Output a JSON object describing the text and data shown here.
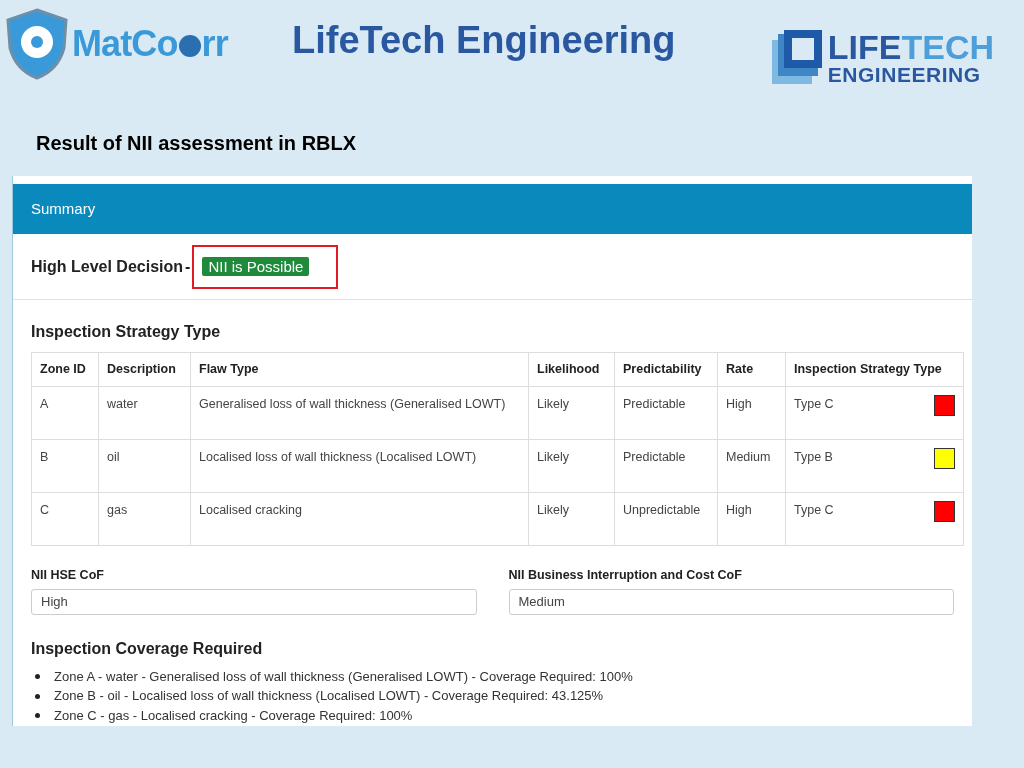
{
  "header": {
    "left_logo": {
      "text_a": "Mat",
      "text_b": "Co",
      "text_c": "rr"
    },
    "title": "LifeTech Engineering",
    "right_logo": {
      "line_1a": "LIFE",
      "line_1b": "TECH",
      "line_2": "ENGINEERING"
    }
  },
  "subtitle": "Result of NII assessment in RBLX",
  "panel": {
    "title": "Summary",
    "decision": {
      "label": "High Level Decision",
      "separator": "-",
      "badge": "NII is Possible",
      "highlighted": true
    },
    "strategy": {
      "heading": "Inspection Strategy Type",
      "columns": [
        "Zone ID",
        "Description",
        "Flaw Type",
        "Likelihood",
        "Predictability",
        "Rate",
        "Inspection Strategy Type"
      ],
      "rows": [
        {
          "cells": [
            "A",
            "water",
            "Generalised loss of wall thickness (Generalised LOWT)",
            "Likely",
            "Predictable",
            "High",
            "Type C"
          ],
          "color": "#ff0000"
        },
        {
          "cells": [
            "B",
            "oil",
            "Localised loss of wall thickness (Localised LOWT)",
            "Likely",
            "Predictable",
            "Medium",
            "Type B"
          ],
          "color": "#ffff00"
        },
        {
          "cells": [
            "C",
            "gas",
            "Localised cracking",
            "Likely",
            "Unpredictable",
            "High",
            "Type C"
          ],
          "color": "#ff0000"
        }
      ]
    },
    "fields": [
      {
        "label": "NII HSE CoF",
        "value": "High"
      },
      {
        "label": "NII Business Interruption and Cost CoF",
        "value": "Medium"
      }
    ],
    "coverage": {
      "heading": "Inspection Coverage Required",
      "items": [
        "Zone A - water - Generalised loss of wall thickness (Generalised LOWT) - Coverage Required: 100%",
        "Zone B - oil - Localised loss of wall thickness (Localised LOWT) - Coverage Required: 43.125%",
        "Zone C - gas - Localised cracking - Coverage Required: 100%"
      ]
    }
  }
}
